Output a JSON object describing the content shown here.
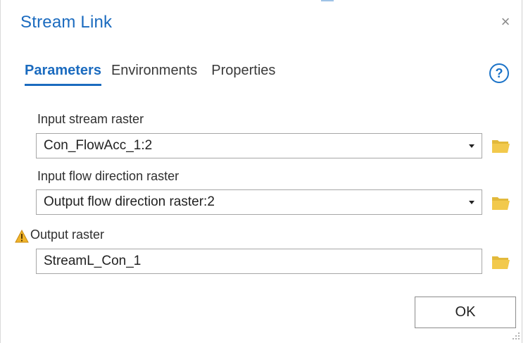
{
  "dialog": {
    "title": "Stream Link",
    "close_label": "×"
  },
  "tabs": [
    {
      "label": "Parameters",
      "active": true
    },
    {
      "label": "Environments",
      "active": false
    },
    {
      "label": "Properties",
      "active": false
    }
  ],
  "help_label": "?",
  "fields": {
    "input_stream": {
      "label": "Input stream raster",
      "value": "Con_FlowAcc_1:2"
    },
    "input_flow": {
      "label": "Input flow direction raster",
      "value": "Output flow direction raster:2"
    },
    "output_raster": {
      "label": "Output raster",
      "value": "StreamL_Con_1",
      "warning": true
    }
  },
  "buttons": {
    "ok_label": "OK"
  },
  "icons": {
    "folder": "folder-open-icon",
    "warning": "warning-icon",
    "help": "help-icon",
    "close": "close-icon"
  },
  "colors": {
    "accent": "#1b6bbf",
    "folder": "#f2c94c",
    "warning": "#f0b429"
  }
}
